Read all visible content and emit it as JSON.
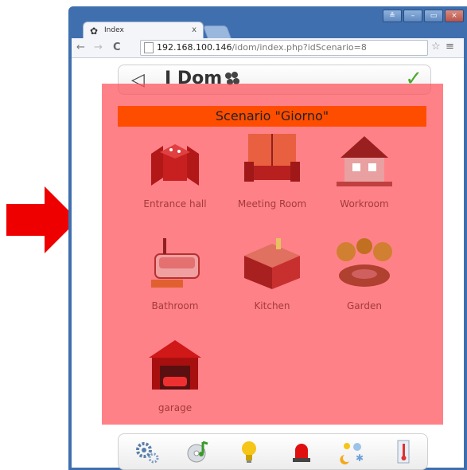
{
  "browser": {
    "tab_title": "Index",
    "tab_close": "x",
    "url_host": "192.168.100.146",
    "url_path": "/idom/index.php?idScenario=8",
    "back": "←",
    "forward": "→",
    "reload": "C",
    "bookmark": "☆",
    "menu": "≡",
    "window_controls": [
      "≗",
      "–",
      "▭",
      "×"
    ]
  },
  "app": {
    "logo_text": "I Dom",
    "back_icon": "◁",
    "confirm_icon": "✓",
    "scenario_title": "Scenario \"Giorno\""
  },
  "rooms": [
    {
      "label": "Entrance hall",
      "icon": "armchair-table-icon"
    },
    {
      "label": "Meeting Room",
      "icon": "living-room-icon"
    },
    {
      "label": "Workroom",
      "icon": "house-icon"
    },
    {
      "label": "Bathroom",
      "icon": "bathtub-icon"
    },
    {
      "label": "Kitchen",
      "icon": "kitchen-icon"
    },
    {
      "label": "Garden",
      "icon": "garden-icon"
    },
    {
      "label": "garage",
      "icon": "garage-icon"
    }
  ],
  "bottom_toolbar": [
    {
      "name": "settings-gears-icon"
    },
    {
      "name": "media-disc-icon"
    },
    {
      "name": "lightbulb-icon"
    },
    {
      "name": "alarm-siren-icon"
    },
    {
      "name": "weather-icon"
    },
    {
      "name": "thermometer-icon"
    }
  ],
  "colors": {
    "overlay": "#ff505a",
    "title_bar": "#ff4d00",
    "arrow": "#ee0000",
    "window_frame": "#3f6fae"
  }
}
